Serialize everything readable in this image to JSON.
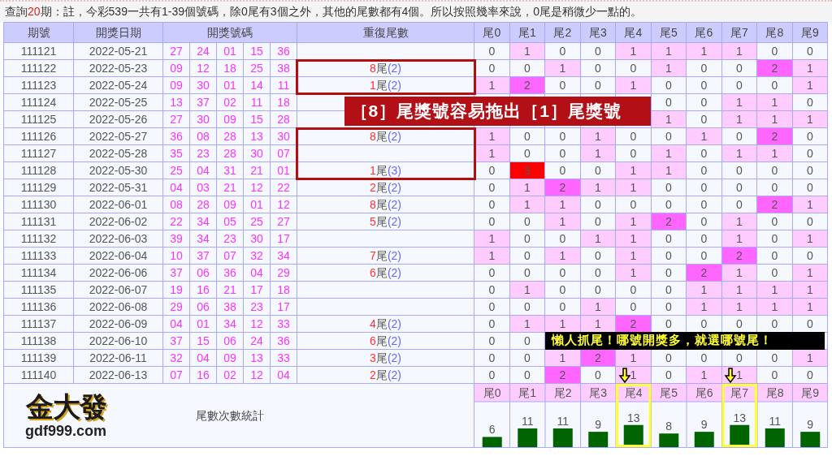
{
  "note": {
    "prefix": "查詢",
    "count": "20",
    "text": "期：註，今彩539一共有1-39個號碼，除0尾有3個之外，其他的尾數都有4個。所以按照幾率來說，0尾是稍微少一點的。"
  },
  "table": {
    "columns": [
      "期號",
      "開獎日期",
      "開獎號碼",
      "重復尾數",
      "尾0",
      "尾1",
      "尾2",
      "尾3",
      "尾4",
      "尾5",
      "尾6",
      "尾7",
      "尾8",
      "尾9"
    ],
    "rows": [
      {
        "period": "111121",
        "date": "2022-05-21",
        "numbers": [
          "27",
          "24",
          "01",
          "15",
          "36"
        ],
        "tails": [
          "0",
          "1",
          "0",
          "0",
          "1",
          "1",
          "1",
          "1",
          "0",
          "0"
        ]
      },
      {
        "period": "111122",
        "date": "2022-05-23",
        "numbers": [
          "09",
          "12",
          "18",
          "25",
          "38"
        ],
        "repeat": {
          "digit": "8",
          "label": "尾",
          "count": "(2)"
        },
        "tails": [
          "0",
          "0",
          "1",
          "0",
          "0",
          "1",
          "0",
          "0",
          "2",
          "1"
        ]
      },
      {
        "period": "111123",
        "date": "2022-05-24",
        "numbers": [
          "09",
          "30",
          "01",
          "14",
          "11"
        ],
        "repeat": {
          "digit": "1",
          "label": "尾",
          "count": "(2)"
        },
        "tails": [
          "1",
          "2",
          "0",
          "0",
          "1",
          "0",
          "0",
          "0",
          "0",
          "1"
        ]
      },
      {
        "period": "111124",
        "date": "2022-05-25",
        "numbers": [
          "13",
          "37",
          "02",
          "11",
          "18"
        ],
        "kind": "banner",
        "tails": [
          "0",
          "0",
          "1",
          "1",
          "0"
        ]
      },
      {
        "period": "111125",
        "date": "2022-05-26",
        "numbers": [
          "27",
          "30",
          "09",
          "15",
          "28"
        ],
        "kind": "banner",
        "tails": [
          "1",
          "0",
          "1",
          "1",
          "1"
        ]
      },
      {
        "period": "111126",
        "date": "2022-05-27",
        "numbers": [
          "36",
          "08",
          "28",
          "13",
          "30"
        ],
        "repeat": {
          "digit": "8",
          "label": "尾",
          "count": "(2)"
        },
        "tails": [
          "1",
          "0",
          "0",
          "1",
          "0",
          "0",
          "1",
          "0",
          "2",
          "0"
        ]
      },
      {
        "period": "111127",
        "date": "2022-05-28",
        "numbers": [
          "35",
          "23",
          "28",
          "30",
          "07"
        ],
        "tails": [
          "1",
          "0",
          "0",
          "1",
          "0",
          "1",
          "0",
          "1",
          "1",
          "0"
        ]
      },
      {
        "period": "111128",
        "date": "2022-05-30",
        "numbers": [
          "25",
          "04",
          "31",
          "21",
          "01"
        ],
        "repeat": {
          "digit": "1",
          "label": "尾",
          "count": "(3)"
        },
        "tails": [
          "0",
          "3",
          "0",
          "0",
          "1",
          "1",
          "0",
          "0",
          "0",
          "0"
        ]
      },
      {
        "period": "111129",
        "date": "2022-05-31",
        "numbers": [
          "04",
          "03",
          "21",
          "12",
          "22"
        ],
        "repeat": {
          "digit": "2",
          "label": "尾",
          "count": "(2)"
        },
        "tails": [
          "0",
          "1",
          "2",
          "1",
          "1",
          "0",
          "0",
          "0",
          "0",
          "0"
        ]
      },
      {
        "period": "111130",
        "date": "2022-06-01",
        "numbers": [
          "08",
          "28",
          "09",
          "01",
          "12"
        ],
        "repeat": {
          "digit": "8",
          "label": "尾",
          "count": "(2)"
        },
        "tails": [
          "0",
          "1",
          "1",
          "0",
          "0",
          "0",
          "0",
          "0",
          "2",
          "1"
        ]
      },
      {
        "period": "111131",
        "date": "2022-06-02",
        "numbers": [
          "22",
          "34",
          "05",
          "25",
          "27"
        ],
        "repeat": {
          "digit": "5",
          "label": "尾",
          "count": "(2)"
        },
        "tails": [
          "0",
          "0",
          "1",
          "0",
          "1",
          "2",
          "0",
          "1",
          "0",
          "0"
        ]
      },
      {
        "period": "111132",
        "date": "2022-06-03",
        "numbers": [
          "39",
          "34",
          "23",
          "30",
          "17"
        ],
        "tails": [
          "1",
          "0",
          "0",
          "1",
          "1",
          "0",
          "0",
          "1",
          "0",
          "1"
        ]
      },
      {
        "period": "111133",
        "date": "2022-06-04",
        "numbers": [
          "10",
          "37",
          "07",
          "32",
          "34"
        ],
        "repeat": {
          "digit": "7",
          "label": "尾",
          "count": "(2)"
        },
        "tails": [
          "1",
          "0",
          "1",
          "0",
          "1",
          "0",
          "0",
          "2",
          "0",
          "0"
        ]
      },
      {
        "period": "111134",
        "date": "2022-06-06",
        "numbers": [
          "37",
          "06",
          "36",
          "04",
          "29"
        ],
        "repeat": {
          "digit": "6",
          "label": "尾",
          "count": "(2)"
        },
        "tails": [
          "0",
          "0",
          "0",
          "0",
          "1",
          "0",
          "2",
          "1",
          "0",
          "1"
        ]
      },
      {
        "period": "111135",
        "date": "2022-06-07",
        "numbers": [
          "19",
          "16",
          "21",
          "17",
          "18"
        ],
        "tails": [
          "0",
          "1",
          "0",
          "0",
          "0",
          "0",
          "1",
          "1",
          "1",
          "1"
        ]
      },
      {
        "period": "111136",
        "date": "2022-06-08",
        "numbers": [
          "29",
          "06",
          "38",
          "23",
          "17"
        ],
        "tails": [
          "0",
          "0",
          "0",
          "1",
          "0",
          "0",
          "1",
          "1",
          "1",
          "1"
        ]
      },
      {
        "period": "111137",
        "date": "2022-06-09",
        "numbers": [
          "04",
          "01",
          "34",
          "12",
          "33"
        ],
        "repeat": {
          "digit": "4",
          "label": "尾",
          "count": "(2)"
        },
        "tails": [
          "0",
          "1",
          "1",
          "1",
          "2",
          "0",
          "0",
          "0",
          "0",
          "0"
        ]
      },
      {
        "period": "111138",
        "date": "2022-06-10",
        "numbers": [
          "37",
          "15",
          "06",
          "24",
          "36"
        ],
        "repeat": {
          "digit": "6",
          "label": "尾",
          "count": "(2)"
        },
        "kind": "callout",
        "tails": [
          "0",
          "0"
        ]
      },
      {
        "period": "111139",
        "date": "2022-06-11",
        "numbers": [
          "32",
          "04",
          "09",
          "13",
          "33"
        ],
        "repeat": {
          "digit": "3",
          "label": "尾",
          "count": "(2)"
        },
        "tails": [
          "0",
          "0",
          "1",
          "2",
          "1",
          "0",
          "0",
          "0",
          "0",
          "1"
        ]
      },
      {
        "period": "111140",
        "date": "2022-06-13",
        "numbers": [
          "07",
          "16",
          "02",
          "12",
          "04"
        ],
        "repeat": {
          "digit": "2",
          "label": "尾",
          "count": "(2)"
        },
        "tails": [
          "0",
          "0",
          "2",
          "0",
          "1",
          "0",
          "1",
          "1",
          "0",
          "0"
        ]
      }
    ]
  },
  "summary": {
    "logo": {
      "name": "金大發",
      "site": "gdf999.com"
    },
    "title": "尾數次數統計",
    "highlighted": [
      false,
      false,
      false,
      false,
      true,
      false,
      false,
      true,
      false,
      false
    ],
    "chart_data": {
      "type": "bar",
      "categories": [
        "尾0",
        "尾1",
        "尾2",
        "尾3",
        "尾4",
        "尾5",
        "尾6",
        "尾7",
        "尾8",
        "尾9"
      ],
      "values": [
        6,
        11,
        11,
        9,
        13,
        8,
        9,
        13,
        11,
        9
      ],
      "data_labels": true
    }
  },
  "annotations": {
    "banner": "［8］尾獎號容易拖出［1］尾獎號",
    "callout": "懶人抓尾！哪號開獎多，就選哪號尾！"
  }
}
